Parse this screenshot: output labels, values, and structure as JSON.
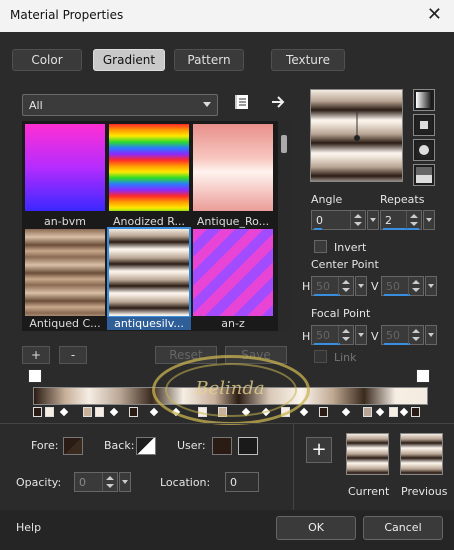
{
  "window": {
    "title": "Material Properties",
    "close_glyph": "✕"
  },
  "tabs": [
    {
      "label": "Color"
    },
    {
      "label": "Gradient"
    },
    {
      "label": "Pattern"
    },
    {
      "label": "Texture"
    }
  ],
  "category": {
    "selected": "All"
  },
  "thumbnails": [
    {
      "caption": "an-bvm"
    },
    {
      "caption": "Anodized R..."
    },
    {
      "caption": "Antique_Ro..."
    },
    {
      "caption": "Antiqued C..."
    },
    {
      "caption": "antiquesilv..."
    },
    {
      "caption": "an-z"
    }
  ],
  "list_buttons": {
    "add": "+",
    "remove": "-",
    "reset": "Reset",
    "save": "Save"
  },
  "angle": {
    "label": "Angle",
    "value": "0"
  },
  "repeats": {
    "label": "Repeats",
    "value": "2"
  },
  "invert": {
    "label": "Invert"
  },
  "center_point": {
    "label": "Center Point",
    "h_label": "H",
    "h_value": "50",
    "v_label": "V",
    "v_value": "50"
  },
  "focal_point": {
    "label": "Focal Point",
    "h_label": "H",
    "h_value": "50",
    "v_label": "V",
    "v_value": "50"
  },
  "link": {
    "label": "Link"
  },
  "stops": {
    "fore_label": "Fore:",
    "back_label": "Back:",
    "user_label": "User:",
    "opacity_label": "Opacity:",
    "opacity_value": "0",
    "location_label": "Location:",
    "location_value": "0"
  },
  "samples": {
    "current": "Current",
    "previous": "Previous",
    "add_glyph": "+"
  },
  "footer": {
    "help": "Help",
    "ok": "OK",
    "cancel": "Cancel"
  },
  "watermark": {
    "text": "Belinda"
  },
  "colors": {
    "accent": "#3a8ee0",
    "panel": "#2b2b2b",
    "active_tab": "#c9c9c9"
  }
}
